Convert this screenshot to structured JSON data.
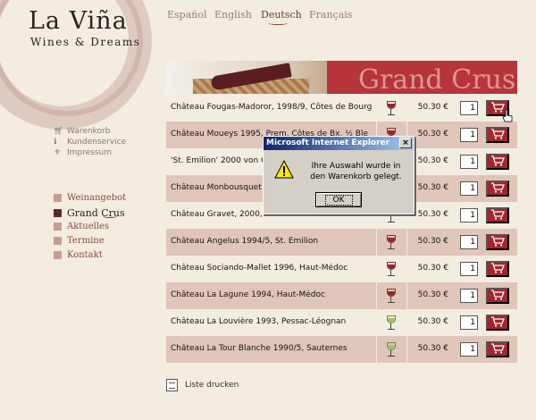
{
  "logo": {
    "title": "La Viña",
    "subtitle": "Wines & Dreams"
  },
  "languages": [
    "Español",
    "English",
    "Deutsch",
    "Français"
  ],
  "utility": [
    {
      "icon": "cart-icon",
      "label": "Warenkorb"
    },
    {
      "icon": "info-icon",
      "label": "Kundenservice"
    },
    {
      "icon": "imprint-icon",
      "label": "Impressum"
    }
  ],
  "nav": [
    "Weinangebot",
    "Grand Crus",
    "Aktuelles",
    "Termine",
    "Kontakt"
  ],
  "banner": {
    "text": "Grand Crus"
  },
  "wines": [
    {
      "name": "Château Fougas-Madoror, 1998/9, Côtes de Bourg",
      "type": "red",
      "price": "50.30 €",
      "qty": "1"
    },
    {
      "name": "Château Moueys 1995, Prem. Côtes de Bx, ½ Ble",
      "type": "red",
      "price": "50.30 €",
      "qty": "1"
    },
    {
      "name": "'St. Emilion' 2000 von C",
      "type": "red",
      "price": "50.30 €",
      "qty": "1"
    },
    {
      "name": "Château Monbousquet",
      "type": "red",
      "price": "50.30 €",
      "qty": "1"
    },
    {
      "name": "Château Gravet, 2000, St. Emilion",
      "type": "red",
      "price": "50.30 €",
      "qty": "1"
    },
    {
      "name": "Château Angelus 1994/5, St. Emilion",
      "type": "red",
      "price": "50.30 €",
      "qty": "1"
    },
    {
      "name": "Château Sociando-Mallet 1996, Haut-Médoc",
      "type": "red",
      "price": "50.30 €",
      "qty": "1"
    },
    {
      "name": "Château La Lagune 1994, Haut-Médoc",
      "type": "red",
      "price": "50.30 €",
      "qty": "1"
    },
    {
      "name": "Château La Louvière 1993, Pessac-Léognan",
      "type": "white",
      "price": "50.30 €",
      "qty": "1"
    },
    {
      "name": "Château La Tour Blanche 1990/5, Sauternes",
      "type": "white",
      "price": "50.30 €",
      "qty": "1"
    }
  ],
  "print": {
    "label": "Liste drucken"
  },
  "dialog": {
    "title": "Microsoft Internet Explorer",
    "message": "Ihre Auswahl wurde in den Warenkorb gelegt.",
    "ok": "OK",
    "close": "×"
  },
  "colors": {
    "accent": "#a3262b",
    "row_band": "#dfc5ba",
    "background": "#f3ece1"
  }
}
